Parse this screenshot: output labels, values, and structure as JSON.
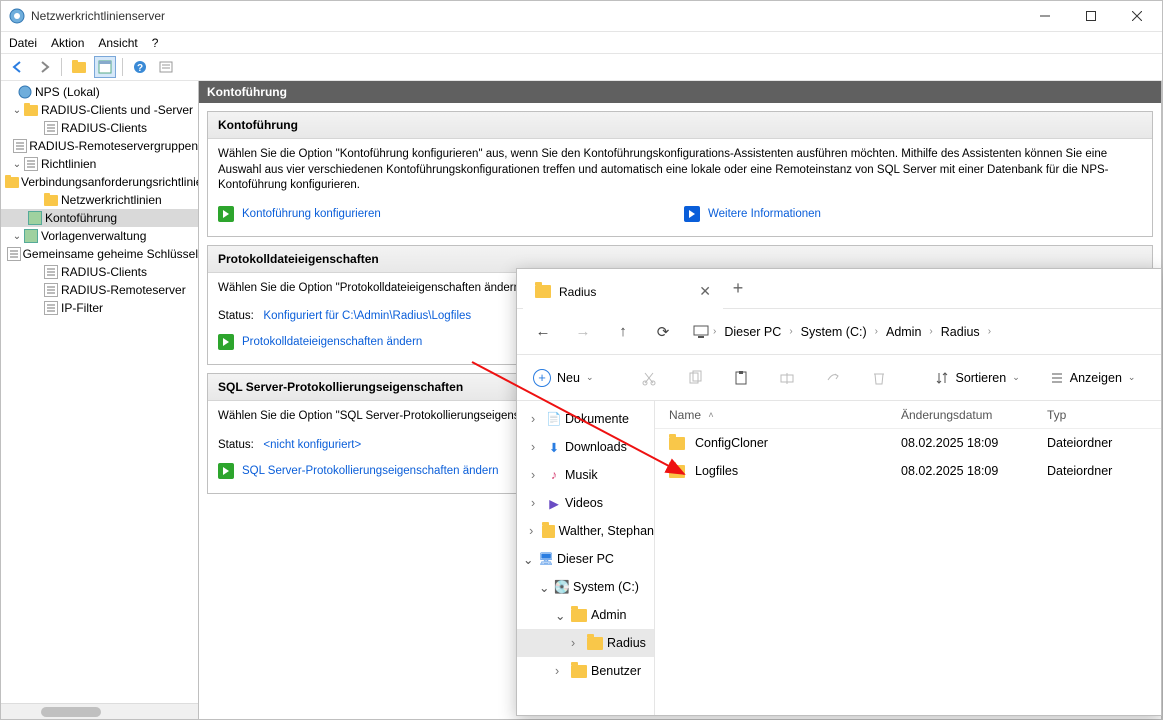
{
  "titlebar": {
    "title": "Netzwerkrichtlinienserver"
  },
  "menubar": {
    "file": "Datei",
    "action": "Aktion",
    "view": "Ansicht",
    "help": "?"
  },
  "tree": {
    "root": "NPS (Lokal)",
    "radius_clients_group": "RADIUS-Clients und -Server",
    "radius_clients": "RADIUS-Clients",
    "radius_remote_groups": "RADIUS-Remoteservergruppen",
    "policies_group": "Richtlinien",
    "conn_request": "Verbindungsanforderungsrichtlinien",
    "network_policies": "Netzwerkrichtlinien",
    "accounting": "Kontoführung",
    "template_mgmt": "Vorlagenverwaltung",
    "shared_secrets": "Gemeinsame geheime Schlüssel",
    "tpl_radius_clients": "RADIUS-Clients",
    "tpl_radius_remote": "RADIUS-Remoteserver",
    "ip_filters": "IP-Filter"
  },
  "content": {
    "header": "Kontoführung",
    "s1": {
      "title": "Kontoführung",
      "text": "Wählen Sie die Option \"Kontoführung konfigurieren\" aus, wenn Sie den Kontoführungskonfigurations-Assistenten ausführen möchten. Mithilfe des Assistenten können Sie eine Auswahl aus vier verschiedenen Kontoführungskonfigurationen treffen und automatisch eine lokale oder eine Remoteinstanz von SQL Server mit einer Datenbank für die NPS-Kontoführung konfigurieren.",
      "link1": "Kontoführung konfigurieren",
      "link2": "Weitere Informationen"
    },
    "s2": {
      "title": "Protokolldateieigenschaften",
      "text": "Wählen Sie die Option \"Protokolldateieigenschaften ändern\" aus.",
      "status_label": "Status:",
      "status_value": "Konfiguriert für C:\\Admin\\Radius\\Logfiles",
      "link": "Protokolldateieigenschaften ändern"
    },
    "s3": {
      "title": "SQL Server-Protokollierungseigenschaften",
      "text": "Wählen Sie die Option \"SQL Server-Protokollierungseigenschaften\".",
      "status_label": "Status:",
      "status_value": "<nicht konfiguriert>",
      "link": "SQL Server-Protokollierungseigenschaften ändern"
    }
  },
  "explorer": {
    "tab_title": "Radius",
    "new_btn": "Neu",
    "sort_btn": "Sortieren",
    "view_btn": "Anzeigen",
    "breadcrumb": [
      "Dieser PC",
      "System (C:)",
      "Admin",
      "Radius"
    ],
    "cols": {
      "name": "Name",
      "date": "Änderungsdatum",
      "type": "Typ"
    },
    "tree": {
      "documents": "Dokumente",
      "downloads": "Downloads",
      "music": "Musik",
      "videos": "Videos",
      "user": "Walther, Stephan",
      "this_pc": "Dieser PC",
      "system_c": "System (C:)",
      "admin": "Admin",
      "radius": "Radius",
      "benutzer": "Benutzer"
    },
    "rows": [
      {
        "name": "ConfigCloner",
        "date": "08.02.2025 18:09",
        "type": "Dateiordner"
      },
      {
        "name": "Logfiles",
        "date": "08.02.2025 18:09",
        "type": "Dateiordner"
      }
    ]
  }
}
